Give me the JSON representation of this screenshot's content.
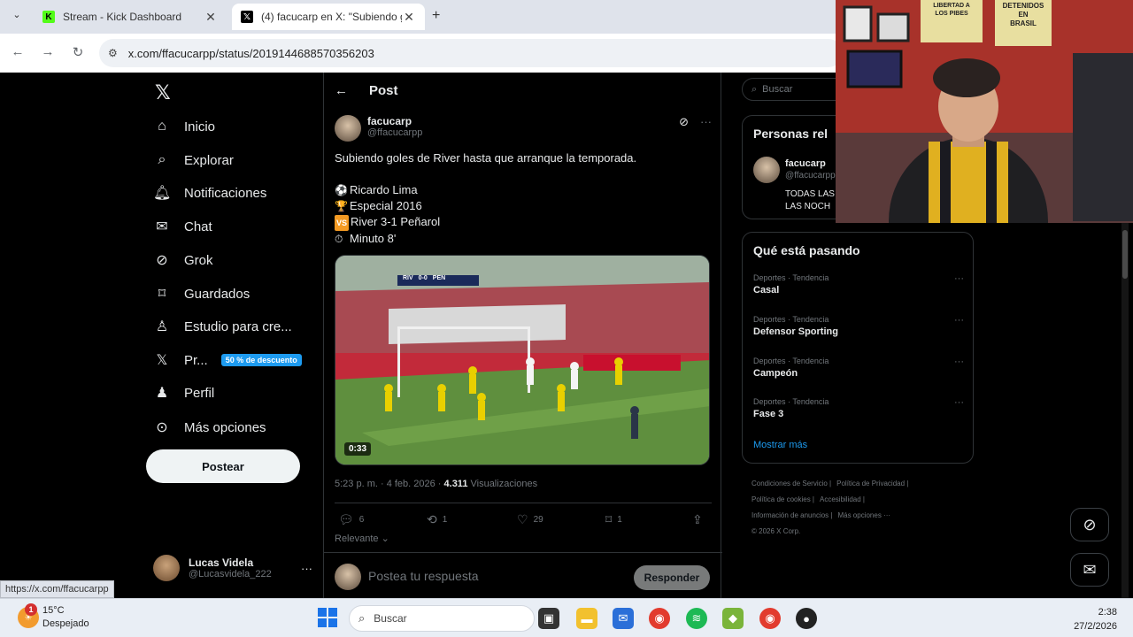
{
  "browser": {
    "tabs": [
      {
        "title": "Stream - Kick Dashboard",
        "favicon": "kick-icon",
        "active": false
      },
      {
        "title": "(4) facucarp en X: \"Subiendo go",
        "favicon": "x-icon",
        "active": true
      }
    ],
    "url": "x.com/ffacucarpp/status/2019144688570356203",
    "status_url": "https://x.com/ffacucarpp"
  },
  "left_nav": {
    "items": [
      {
        "label": "Inicio",
        "icon": "home-icon"
      },
      {
        "label": "Explorar",
        "icon": "search-icon"
      },
      {
        "label": "Notificaciones",
        "icon": "bell-icon"
      },
      {
        "label": "Chat",
        "icon": "mail-icon"
      },
      {
        "label": "Grok",
        "icon": "grok-icon"
      },
      {
        "label": "Guardados",
        "icon": "bookmark-icon"
      },
      {
        "label": "Estudio para cre...",
        "icon": "creator-icon"
      },
      {
        "label": "Pr...",
        "icon": "x-premium-icon"
      },
      {
        "label": "Perfil",
        "icon": "person-icon"
      },
      {
        "label": "Más opciones",
        "icon": "more-circle-icon"
      }
    ],
    "premium_badge": "50 % de descuento",
    "post_button": "Postear",
    "profile": {
      "name": "Lucas Videla",
      "handle": "@Lucasvidela_222",
      "more": "···"
    }
  },
  "post": {
    "header": "Post",
    "author_name": "facucarp",
    "author_handle": "@ffacucarpp",
    "text": "Subiendo goles de River hasta que arranque la temporada.",
    "lines": [
      {
        "emoji": "⚽",
        "text": "Ricardo Lima"
      },
      {
        "emoji": "🏆",
        "text": "Especial 2016"
      },
      {
        "emoji": "VS",
        "text": "River 3-1 Peñarol"
      },
      {
        "emoji": "⏱",
        "text": "Minuto 8'"
      }
    ],
    "video_duration": "0:33",
    "scoreboard": {
      "home": "RIV",
      "score": "0-0",
      "away": "PEN"
    },
    "time": "5:23 p. m. · 4 feb. 2026 · ",
    "views_count": "4.311",
    "views_label": " Visualizaciones",
    "replies": "6",
    "reposts": "1",
    "likes": "29",
    "bookmarks": "1",
    "sort_label": "Relevante",
    "reply_placeholder": "Postea tu respuesta",
    "reply_button": "Responder"
  },
  "right": {
    "search_placeholder": "Buscar",
    "people_title": "Personas rel",
    "person": {
      "name": "facucarp",
      "handle": "@ffacucarpp",
      "bio": "TODAS LAS\nLAS NOCH"
    },
    "trends_title": "Qué está pasando",
    "trends": [
      {
        "category": "Deportes · Tendencia",
        "name": "Casal"
      },
      {
        "category": "Deportes · Tendencia",
        "name": "Defensor Sporting"
      },
      {
        "category": "Deportes · Tendencia",
        "name": "Campeón"
      },
      {
        "category": "Deportes · Tendencia",
        "name": "Fase 3"
      }
    ],
    "show_more": "Mostrar más",
    "footer": [
      "Condiciones de Servicio |",
      "Política de Privacidad |",
      "Política de cookies |",
      "Accesibilidad |",
      "Información de anuncios |",
      "Más opciones ···",
      "© 2026 X Corp."
    ]
  },
  "taskbar": {
    "weather_temp": "15°C",
    "weather_desc": "Despejado",
    "weather_badge": "1",
    "search_placeholder": "Buscar",
    "time": "2:38",
    "date": "27/2/2026"
  },
  "webcam": {
    "sign1": "LIBERTAD A\nLOS PIBES",
    "sign2": "DETENIDOS\nEN\nBRASIL"
  }
}
